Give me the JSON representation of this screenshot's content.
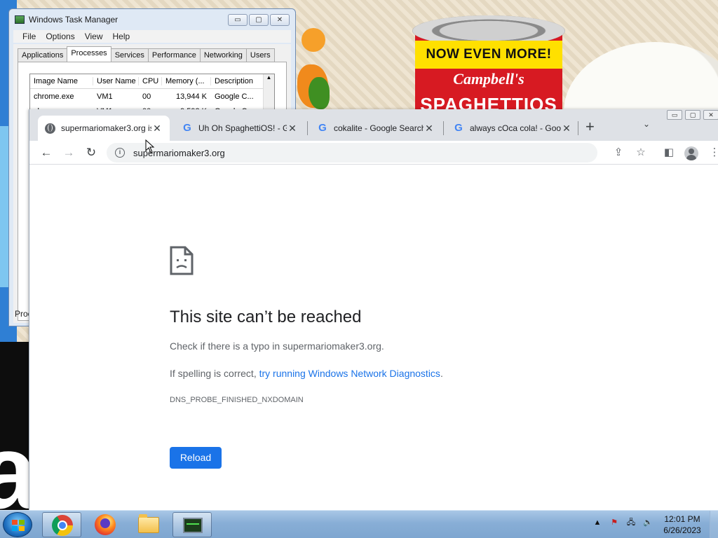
{
  "desktop": {
    "can_band_text": "NOW EVEN MORE!",
    "can_brand_text": "Campbell's",
    "can_product_text": "SPAGHETTIOS"
  },
  "task_manager": {
    "title": "Windows Task Manager",
    "controls": [
      "▭",
      "▢",
      "✕"
    ],
    "menu": [
      "File",
      "Options",
      "View",
      "Help"
    ],
    "tabs": [
      "Applications",
      "Processes",
      "Services",
      "Performance",
      "Networking",
      "Users"
    ],
    "active_tab": "Processes",
    "columns": [
      "Image Name",
      "User Name",
      "CPU",
      "Memory (...",
      "Description"
    ],
    "rows": [
      [
        "chrome.exe",
        "VM1",
        "00",
        "13,944 K",
        "Google C..."
      ],
      [
        "chrome.exe",
        "VM1",
        "00",
        "9,592 K",
        "Google C..."
      ]
    ],
    "status_text": "Proc"
  },
  "chrome": {
    "window_controls": [
      "▭",
      "▢",
      "✕"
    ],
    "tabs": [
      {
        "title": "supermariomaker3.org is",
        "icon": "globe-icon",
        "active": true
      },
      {
        "title": "Uh Oh SpaghettiOS! - G",
        "icon": "google-g-icon",
        "active": false
      },
      {
        "title": "cokalite - Google Search",
        "icon": "google-g-icon",
        "active": false
      },
      {
        "title": "always cOca cola! - Goo",
        "icon": "google-g-icon",
        "active": false
      }
    ],
    "tab_close_glyph": "✕",
    "new_tab_glyph": "+",
    "tab_search_glyph": "⌄",
    "nav": {
      "back": "←",
      "forward": "→",
      "reload": "↻"
    },
    "address": "supermariomaker3.org",
    "info_glyph": "i",
    "toolbar_right": {
      "share": "⇪",
      "bookmark": "☆",
      "sidepanel": "◧",
      "menu": "⋮"
    }
  },
  "error_page": {
    "heading": "This site can’t be reached",
    "typo_line": "Check if there is a typo in supermariomaker3.org.",
    "spelling_prefix": "If spelling is correct, ",
    "diagnostics_link": "try running Windows Network Diagnostics",
    "spelling_suffix": ".",
    "error_code": "DNS_PROBE_FINISHED_NXDOMAIN",
    "reload_label": "Reload",
    "accent_color": "#1a73e8"
  },
  "taskbar": {
    "pinned": [
      "chrome-icon",
      "firefox-icon",
      "explorer-icon",
      "task-manager-icon"
    ],
    "tray_icons": {
      "show_hidden": "▲",
      "action_center": "⚑",
      "network": "🖧",
      "volume": "🔈"
    },
    "time": "12:01 PM",
    "date": "6/26/2023"
  }
}
